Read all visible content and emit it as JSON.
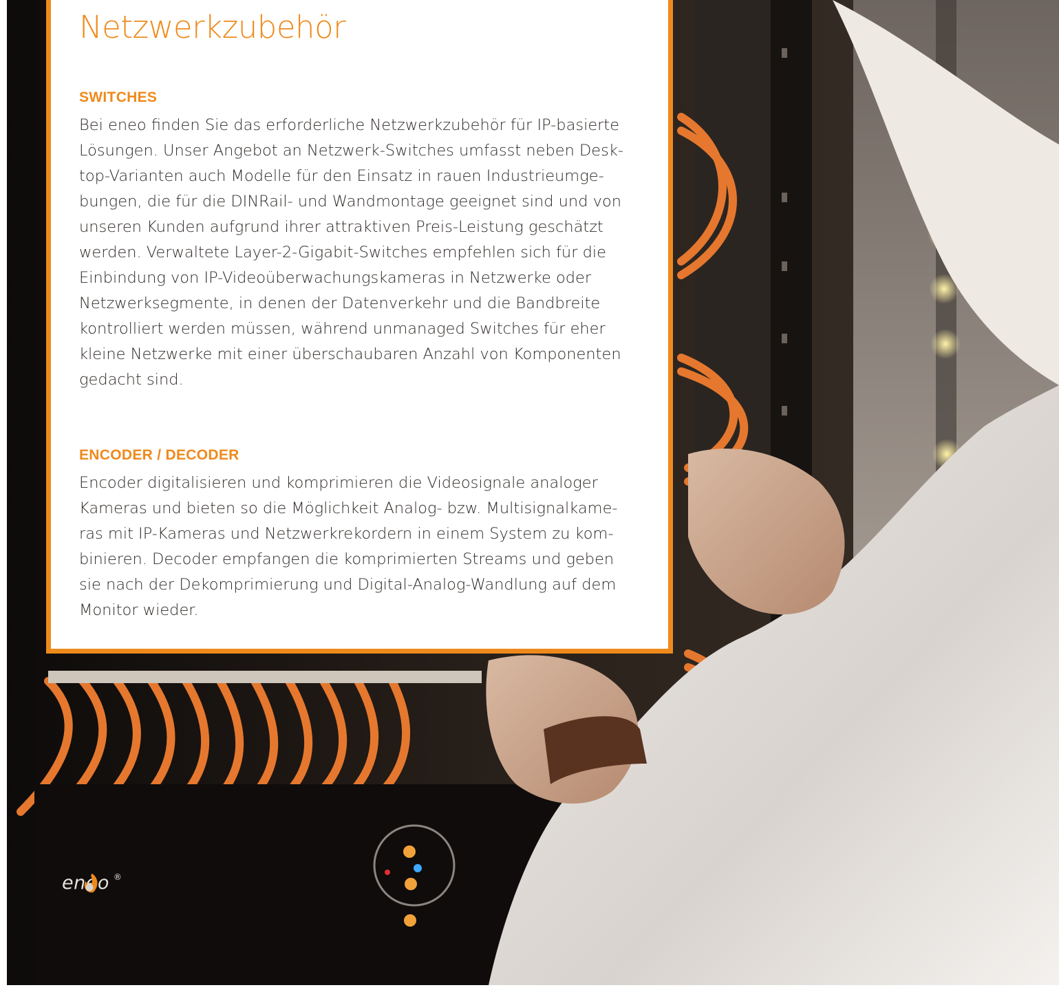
{
  "page": {
    "title": "Netzwerkzubehör",
    "accent_color": "#ee8a1c"
  },
  "sections": [
    {
      "heading": "SWITCHES",
      "lines": [
        "Bei eneo finden Sie das erforderliche Netzwerkzubehör für IP-basierte",
        "Lösungen. Unser Angebot an Netzwerk-Switches umfasst neben Desk-",
        "top-Varianten auch Modelle für den Einsatz in rauen Industrieumge-",
        "bungen, die für die DINRail- und Wandmontage geeignet sind und von",
        "unseren Kunden aufgrund ihrer attraktiven Preis-Leistung geschätzt",
        "werden. Verwaltete Layer-2-Gigabit-Switches empfehlen sich für die",
        "Einbindung von IP-Videoüberwachungskameras in Netzwerke oder",
        "Netzwerksegmente, in denen der Datenverkehr und die Bandbreite",
        "kontrolliert werden müssen, während unmanaged Switches für eher",
        "kleine Netzwerke mit einer überschaubaren Anzahl von Komponenten",
        "gedacht sind."
      ]
    },
    {
      "heading": "ENCODER / DECODER",
      "lines": [
        "Encoder digitalisieren und komprimieren die Videosignale analoger",
        "Kameras und bieten so die Möglichkeit Analog- bzw. Multisignalkame-",
        "ras mit IP-Kameras und Netzwerkrekordern in einem System zu kom-",
        "binieren. Decoder empfangen die komprimierten Streams und geben",
        "sie nach der Dekomprimierung und Digital-Analog-Wandlung auf dem",
        "Monitor wieder."
      ]
    }
  ],
  "photo": {
    "logo_text": "eneo",
    "logo_mark": "®"
  }
}
